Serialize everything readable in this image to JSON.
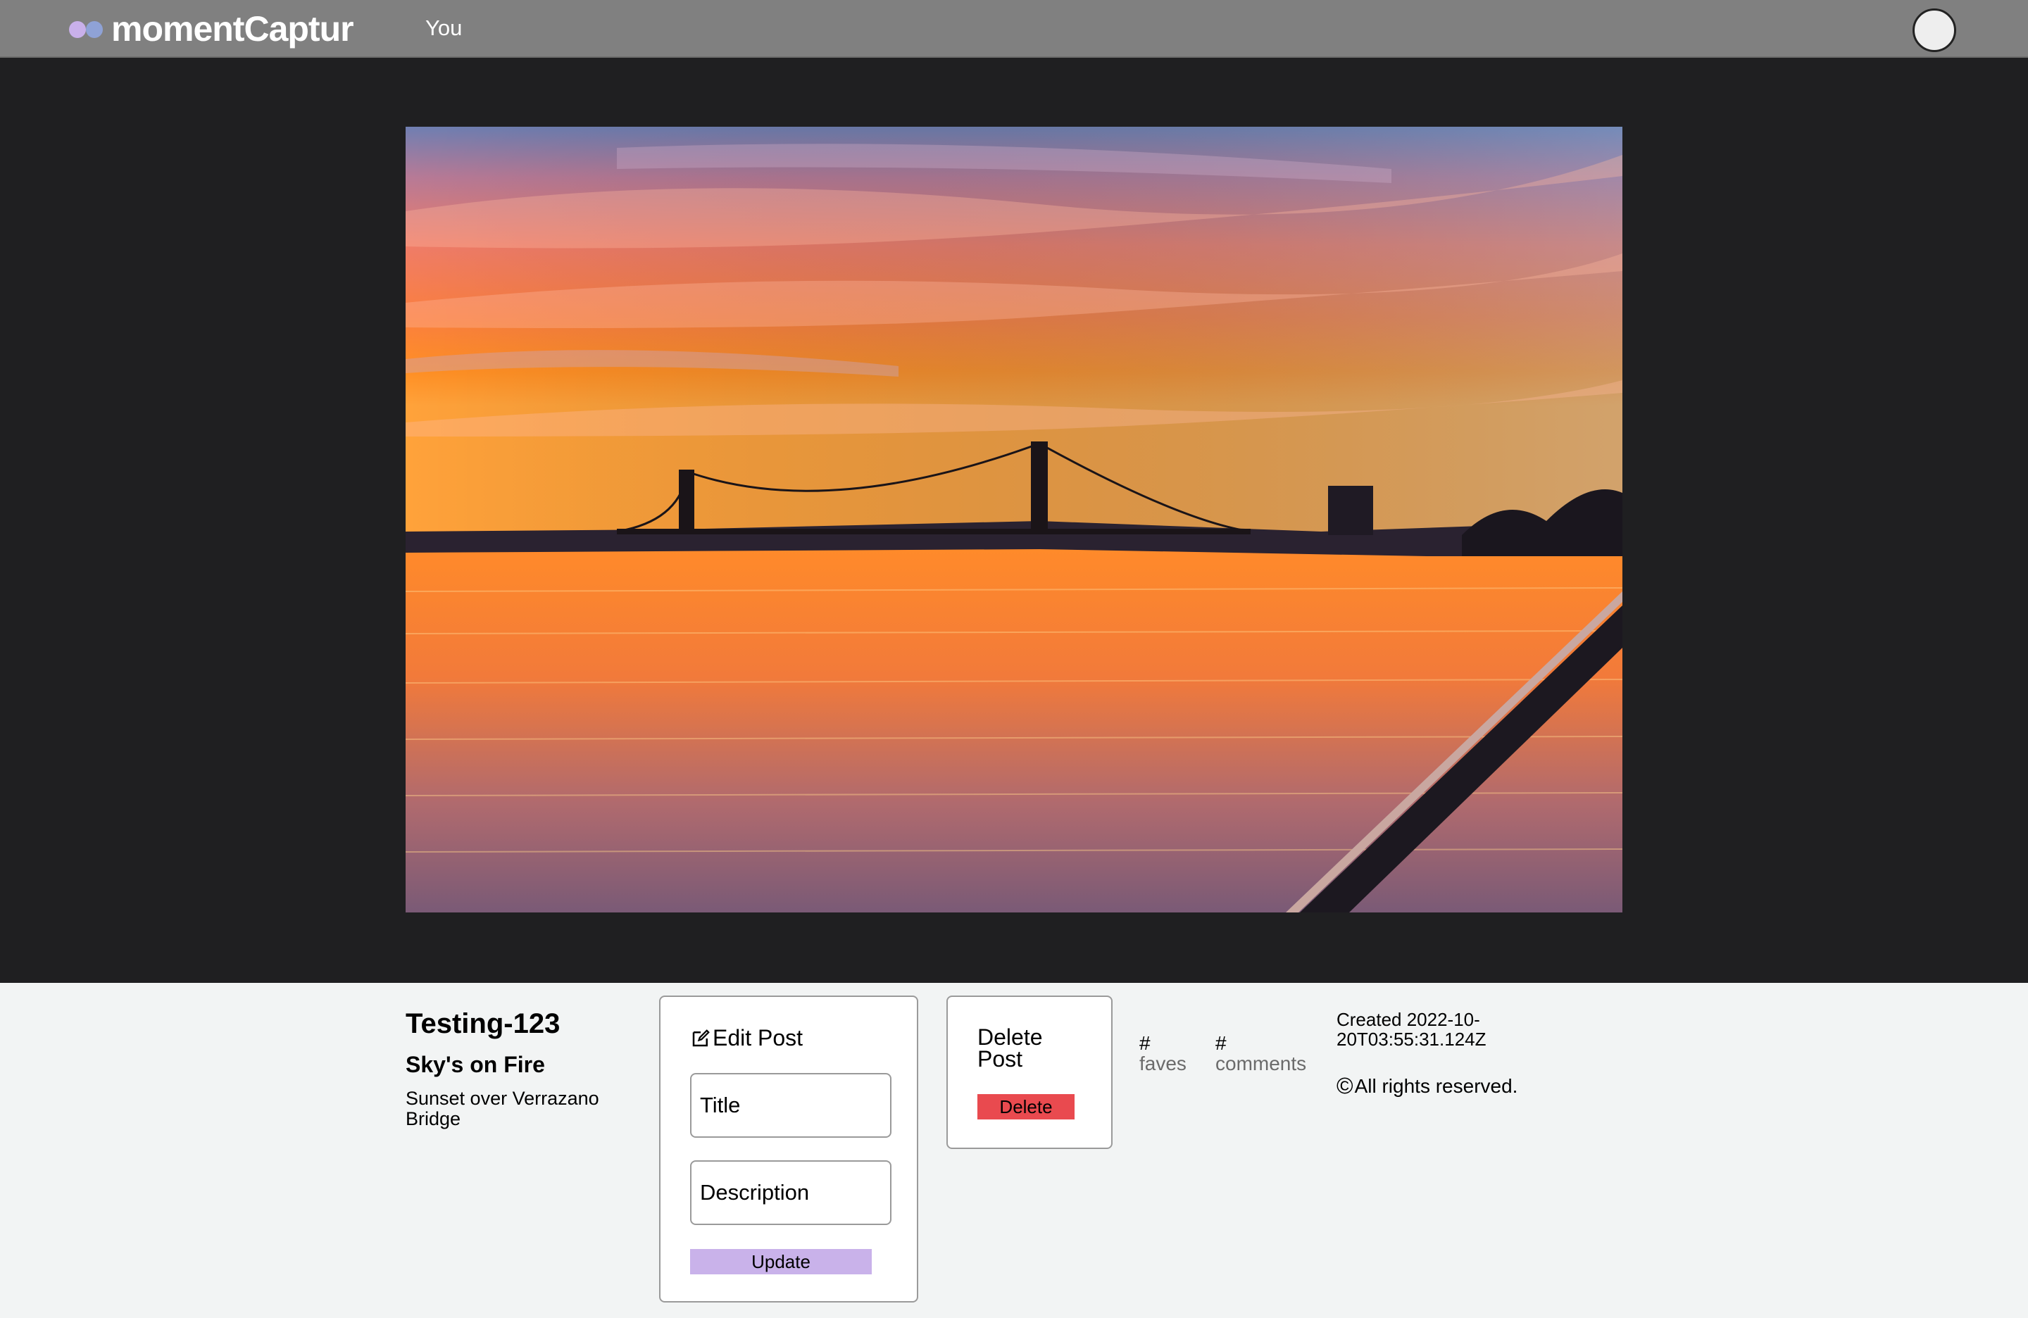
{
  "brand": {
    "name": "momentCaptur",
    "dot_colors": [
      "#c9b0ea",
      "#8fa2d6"
    ]
  },
  "nav": {
    "you_label": "You"
  },
  "post": {
    "code": "Testing-123",
    "title": "Sky's on Fire",
    "description": "Sunset over Verrazano Bridge",
    "created": "Created 2022-10-20T03:55:31.124Z",
    "rights": "All rights reserved.",
    "copyright_symbol": "©"
  },
  "edit": {
    "heading": "Edit Post",
    "title_placeholder": "Title",
    "description_placeholder": "Description",
    "update_label": "Update"
  },
  "delete": {
    "heading": "Delete Post",
    "button_label": "Delete"
  },
  "stats": {
    "faves": {
      "value": "#",
      "label": "faves"
    },
    "comments": {
      "value": "#",
      "label": "comments"
    }
  },
  "colors": {
    "update_button": "#c9b2ea",
    "delete_button": "#e94a4f",
    "topbar": "#808080",
    "stage": "#1f1f21"
  }
}
